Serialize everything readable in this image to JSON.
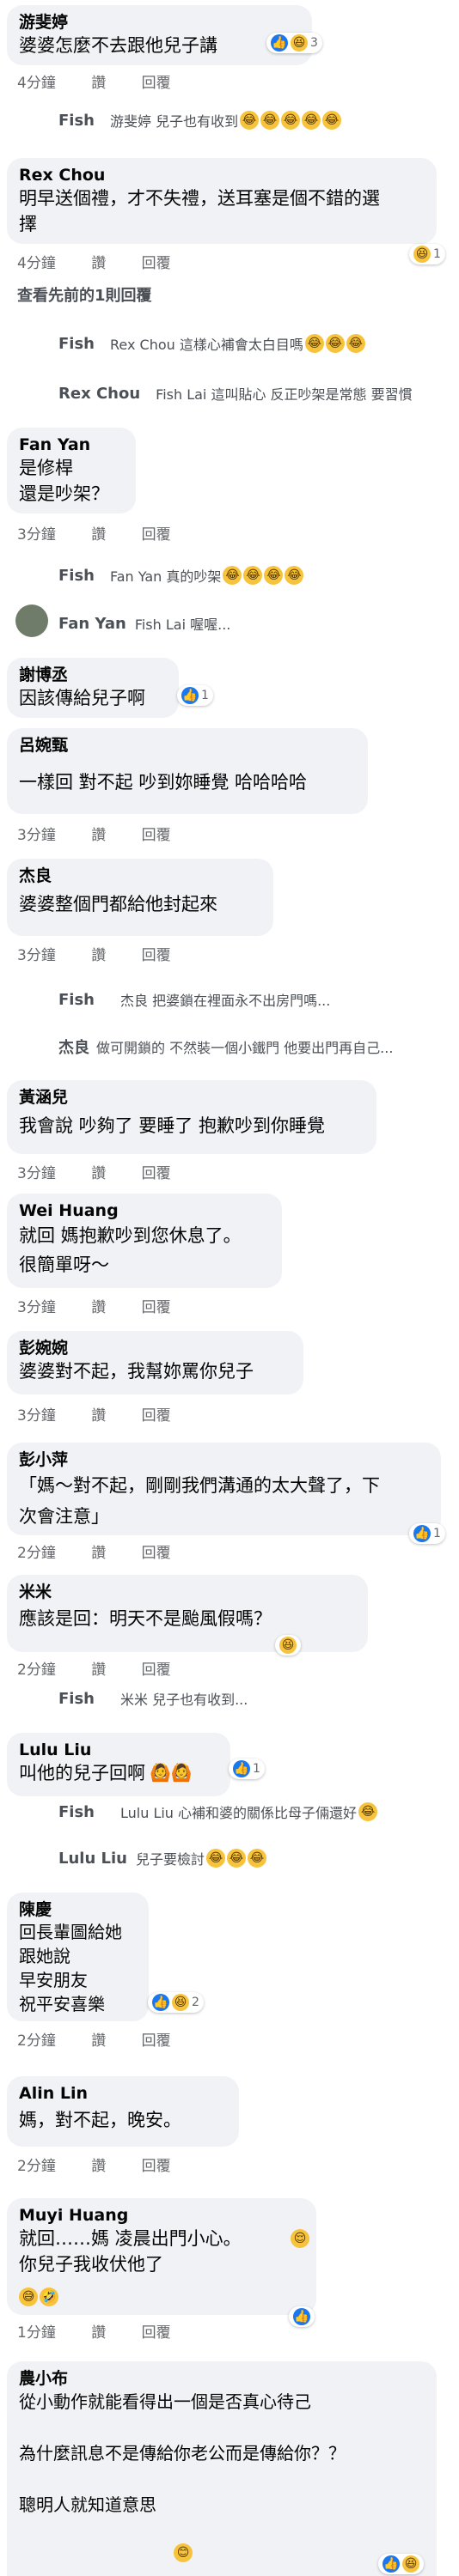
{
  "labels": {
    "reply": "回覆",
    "like": "讚"
  },
  "comments": [
    {
      "id": "c1",
      "name": "游斐婷",
      "text": "婆婆怎麼不去跟他兒子講",
      "time": "4分鐘",
      "react_count": "3"
    },
    {
      "id": "c2",
      "name": "Rex Chou",
      "text": "明早送個禮，才不失禮，送耳塞是個不錯的選\n擇",
      "time": "4分鐘",
      "react_count": ""
    },
    {
      "id": "c3",
      "name": "Fan Yan",
      "text": "是修桿\n還是吵架？",
      "time": "3分鐘"
    },
    {
      "id": "c4",
      "name": "謝博丞",
      "text": "因該傳給兒子啊",
      "react_count": "1"
    },
    {
      "id": "c5",
      "name": "呂婉甄",
      "text": "一樣回  對不起  吵到妳睡覺  哈哈哈哈",
      "time": "3分鐘"
    },
    {
      "id": "c6",
      "name": "杰良",
      "text": "婆婆整個門都給他封起來",
      "time": "3分鐘"
    },
    {
      "id": "c7",
      "name": "黃涵兒",
      "text": "我會說  吵夠了  要睡了  抱歉吵到你睡覺",
      "time": "3分鐘"
    },
    {
      "id": "c8",
      "name": "Wei Huang",
      "text": "就回 媽抱歉吵到您休息了。\n很簡單呀～",
      "time": "3分鐘"
    },
    {
      "id": "c9",
      "name": "彭婉婉",
      "text": "婆婆對不起，我幫妳罵你兒子",
      "time": "3分鐘"
    },
    {
      "id": "c10",
      "name": "彭小萍",
      "text": "「媽～對不起，剛剛我們溝通的太大聲了，下\n次會注意」",
      "time": "2分鐘",
      "react_count": "1"
    },
    {
      "id": "c11",
      "name": "米米",
      "text": "應該是回：明天不是颱風假嗎？",
      "time": "2分鐘"
    },
    {
      "id": "c12",
      "name": "Lulu Liu",
      "text": "叫他的兒子回啊",
      "time": "2分鐘",
      "react_count": "1"
    },
    {
      "id": "c13",
      "name": "陳慶",
      "text": "回長輩圖給她\n跟她說\n早安朋友\n祝平安喜樂",
      "time": "2分鐘",
      "react_count": "2"
    },
    {
      "id": "c14",
      "name": "Alin Lin",
      "text": "媽，對不起，晚安。",
      "time": "2分鐘"
    },
    {
      "id": "c15",
      "name": "Muyi Huang",
      "text": "就回……媽 凌晨出門小心。\n你兒子我收伏他了",
      "time": "1分鐘"
    },
    {
      "id": "c16",
      "name": "農小布",
      "text": "從小動作就能看得出一個是否真心待己\n\n為什麼訊息不是傳給你老公而是傳給你？？\n\n聰明人就知道意思"
    }
  ],
  "replies": [
    {
      "id": "r1",
      "name": "Fish",
      "text": "游斐婷 兒子也有收到"
    },
    {
      "id": "r2",
      "name": "Fish",
      "text": "Rex Chou 這樣心補會太白目嗎"
    },
    {
      "id": "r3",
      "name": "Rex Chou",
      "text": "Fish Lai 這叫貼心 反正吵架是常態 要習慣"
    },
    {
      "id": "r4",
      "name": "Fish",
      "text": "Fan Yan 真的吵架"
    },
    {
      "id": "r5",
      "name": "Fan Yan",
      "text": "Fish Lai 喔喔..."
    },
    {
      "id": "r6",
      "name": "Fish",
      "text": "杰良 把婆鎖在裡面永不出房門嗎..."
    },
    {
      "id": "r7",
      "name": "杰良",
      "text": "做可開鎖的 不然裝一個小鐵門 他要出門再自己..."
    },
    {
      "id": "r8",
      "name": "Fish",
      "text": "米米 兒子也有收到..."
    },
    {
      "id": "r9",
      "name": "Fish",
      "text": "Lulu Liu 心補和婆的關係比母子倆還好"
    },
    {
      "id": "r10",
      "name": "Lulu Liu",
      "text": "兒子要檢討"
    }
  ],
  "view_previous": "查看先前的1則回覆",
  "partial_count": "1"
}
